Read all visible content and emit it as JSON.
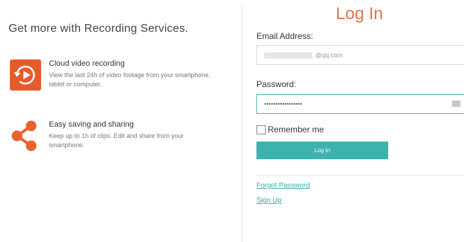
{
  "promo": {
    "title": "Get more with Recording Services.",
    "features": [
      {
        "title": "Cloud video recording",
        "description": "View the last 24h of video footage from your smartphone, tablet or computer.",
        "icon": "play-rewind-icon"
      },
      {
        "title": "Easy saving and sharing",
        "description": "Keep up to 1h of clips. Edit and share from your smartphone.",
        "icon": "share-icon"
      }
    ]
  },
  "login": {
    "title": "Log In",
    "email_label": "Email Address:",
    "email_value": "@qq.com",
    "password_label": "Password:",
    "password_value": "•••••••••••••••••",
    "remember_label": "Remember me",
    "button_label": "Log In",
    "forgot_label": "Forgot Password",
    "signup_label": "Sign Up"
  },
  "colors": {
    "accent": "#3db3b0",
    "title_orange": "#e0734f",
    "cloud_icon": "#e65b2b",
    "share_icon": "#e9622c"
  }
}
